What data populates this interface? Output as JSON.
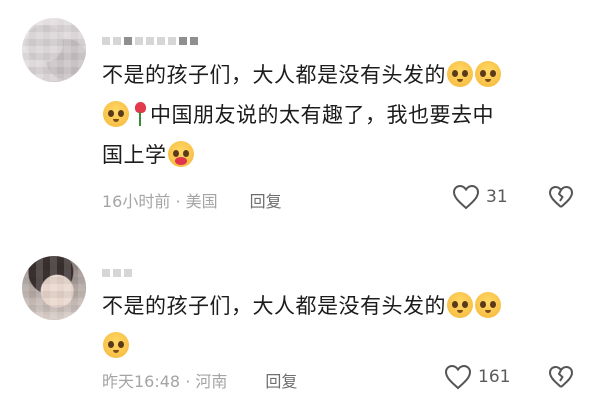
{
  "comments": [
    {
      "line1": "不是的孩子们，大人都是没有头发的",
      "line2": "中国朋友说的太有趣了，我也要去中",
      "line3": "国上学",
      "time_location": "16小时前 · 美国",
      "reply_label": "回复",
      "like_count": "31"
    },
    {
      "line1": "不是的孩子们，大人都是没有头发的",
      "time_location": "昨天16:48 · 河南",
      "reply_label": "回复",
      "like_count": "161"
    }
  ],
  "icons": {
    "like": "heart-outline-icon",
    "dislike": "broken-heart-outline-icon",
    "emoji_pleading": "pleading-face-emoji",
    "emoji_heart": "face-holding-heart-emoji",
    "rose": "rose-emoji"
  }
}
